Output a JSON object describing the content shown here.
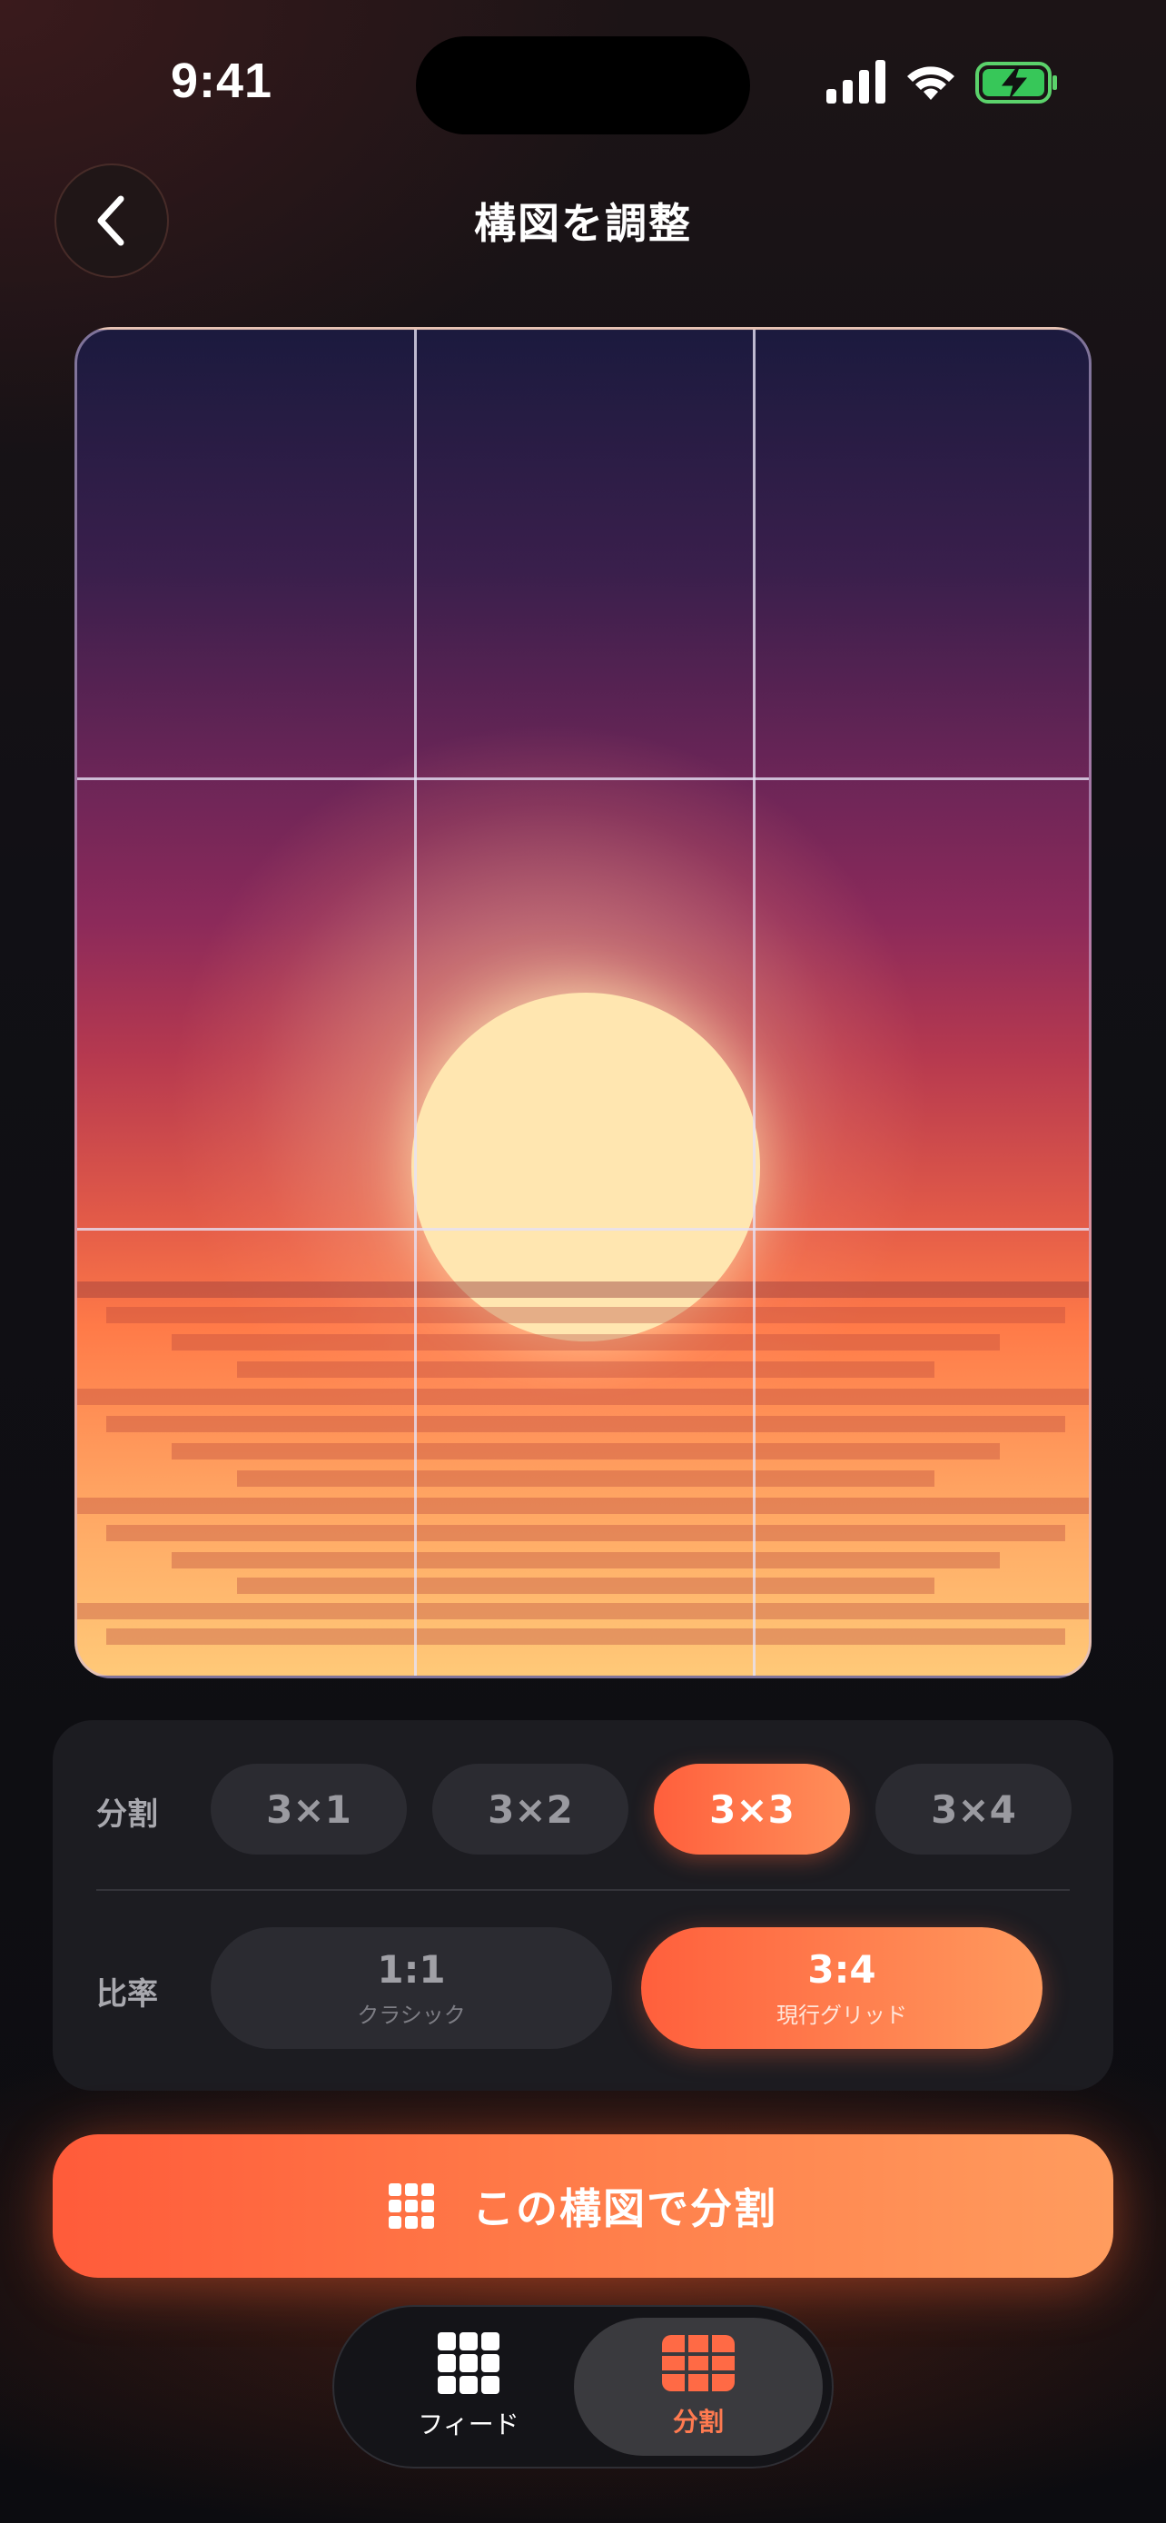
{
  "status_bar": {
    "time": "9:41"
  },
  "header": {
    "title": "構図を調整",
    "back_icon": "chevron-left-icon"
  },
  "preview": {
    "grid_columns": 3,
    "grid_rows": 3,
    "description_colors": {
      "sky_top": "#1b1a3e",
      "horizon": "#e25a48",
      "sea_bottom": "#ffc978",
      "sun": "#ffe6b0"
    }
  },
  "controls": {
    "split_label": "分割",
    "split_options": [
      {
        "label": "3×1",
        "active": false
      },
      {
        "label": "3×2",
        "active": false
      },
      {
        "label": "3×3",
        "active": true
      },
      {
        "label": "3×4",
        "active": false
      }
    ],
    "ratio_label": "比率",
    "ratio_options": [
      {
        "label": "1:1",
        "sub": "クラシック",
        "active": false
      },
      {
        "label": "3:4",
        "sub": "現行グリッド",
        "active": true
      }
    ]
  },
  "cta": {
    "label": "この構図で分割",
    "icon": "grid-icon"
  },
  "tabbar": {
    "items": [
      {
        "label": "フィード",
        "icon": "feed-grid-icon",
        "active": false
      },
      {
        "label": "分割",
        "icon": "split-grid-icon",
        "active": true
      }
    ]
  },
  "colors": {
    "accent": "#ff6a45",
    "accent_end": "#ff9c5e",
    "panel": "#1c1c21",
    "pill": "#2b2b31"
  }
}
